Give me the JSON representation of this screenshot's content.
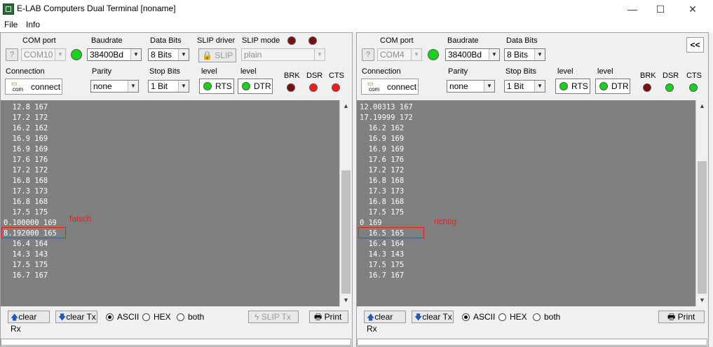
{
  "window": {
    "title": "E-LAB Computers Dual Terminal [noname]",
    "minimize": "—",
    "maximize": "☐",
    "close": "✕"
  },
  "menu": [
    "File",
    "Info"
  ],
  "left": {
    "com_port_label": "COM port",
    "com_port": "COM10",
    "baud_label": "Baudrate",
    "baud": "38400Bd",
    "databits_label": "Data Bits",
    "databits": "8 Bits",
    "slip_driver_label": "SLIP driver",
    "slip_button": "SLIP",
    "slip_mode_label": "SLIP mode",
    "slip_mode": "plain",
    "connection_label": "Connection",
    "connect_button": "connect",
    "com_text": "com",
    "parity_label": "Parity",
    "parity": "none",
    "stopbits_label": "Stop Bits",
    "stopbits": "1 Bit",
    "level1_label": "level",
    "rts": "RTS",
    "level2_label": "level",
    "dtr": "DTR",
    "brk": "BRK",
    "dsr": "DSR",
    "cts": "CTS",
    "terminal_lines": [
      "  12.8 167",
      "  17.2 172",
      "  16.2 162",
      "  16.9 169",
      "  16.9 169",
      "  17.6 176",
      "  17.2 172",
      "  16.8 168",
      "  17.3 173",
      "  16.8 168",
      "  17.5 175",
      "0.100000 169",
      "8.192000 165",
      "  16.4 164",
      "  14.3 143",
      "  17.5 175",
      "  16.7 167"
    ],
    "annotation": "falsch",
    "clear_rx": "clear Rx",
    "clear_tx": "clear Tx",
    "ascii": "ASCII",
    "hex": "HEX",
    "both": "both",
    "slip_tx": "SLIP Tx",
    "print": "Print"
  },
  "right": {
    "com_port_label": "COM port",
    "com_port": "COM4",
    "baud_label": "Baudrate",
    "baud": "38400Bd",
    "databits_label": "Data Bits",
    "databits": "8 Bits",
    "collapse_button": "<<",
    "connection_label": "Connection",
    "connect_button": "connect",
    "com_text": "com",
    "parity_label": "Parity",
    "parity": "none",
    "stopbits_label": "Stop Bits",
    "stopbits": "1 Bit",
    "level1_label": "level",
    "rts": "RTS",
    "level2_label": "level",
    "dtr": "DTR",
    "brk": "BRK",
    "dsr": "DSR",
    "cts": "CTS",
    "terminal_lines": [
      "12.00313 167",
      "17.19999 172",
      "  16.2 162",
      "  16.9 169",
      "  16.9 169",
      "  17.6 176",
      "  17.2 172",
      "  16.8 168",
      "  17.3 173",
      "  16.8 168",
      "  17.5 175",
      "0 169",
      "  16.5 165",
      "  16.4 164",
      "  14.3 143",
      "  17.5 175",
      "  16.7 167"
    ],
    "annotation": "richtig",
    "clear_rx": "clear Rx",
    "clear_tx": "clear Tx",
    "ascii": "ASCII",
    "hex": "HEX",
    "both": "both",
    "print": "Print"
  },
  "colors": {
    "terminal_bg": "#808080",
    "led_on": "#19d219",
    "led_off_dark": "#7a0f0f",
    "led_alert": "#ff1a1a",
    "annotation": "#e02020"
  },
  "icons": [
    "question-icon",
    "lock-icon",
    "serial-port-icon",
    "arrow-up-icon",
    "arrow-down-icon",
    "lightning-icon",
    "printer-icon"
  ]
}
